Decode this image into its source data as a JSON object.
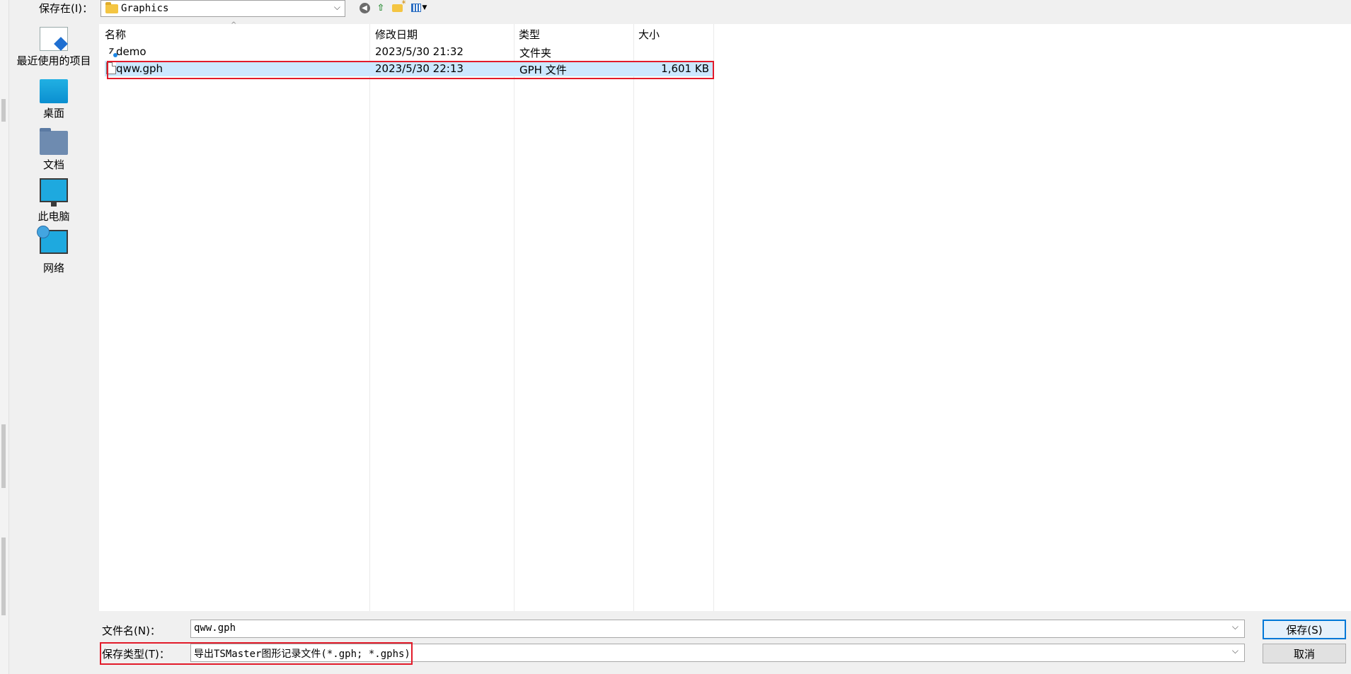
{
  "toolbar": {
    "save_in_label": "保存在(I)：",
    "location": "Graphics"
  },
  "places": [
    {
      "label": "最近使用的项目",
      "icon": "recent-items-icon"
    },
    {
      "label": "桌面",
      "icon": "desktop-icon"
    },
    {
      "label": "文档",
      "icon": "documents-icon"
    },
    {
      "label": "此电脑",
      "icon": "this-pc-icon"
    },
    {
      "label": "网络",
      "icon": "network-icon"
    }
  ],
  "columns": {
    "name": "名称",
    "date": "修改日期",
    "type": "类型",
    "size": "大小"
  },
  "files": [
    {
      "name": "demo",
      "date": "2023/5/30 21:32",
      "type": "文件夹",
      "size": ""
    },
    {
      "name": "qww.gph",
      "date": "2023/5/30 22:13",
      "type": "GPH 文件",
      "size": "1,601 KB"
    }
  ],
  "filename": {
    "label": "文件名(N)：",
    "value": "qww.gph"
  },
  "filetype": {
    "label": "保存类型(T)：",
    "value": "导出TSMaster图形记录文件(*.gph; *.gphs)"
  },
  "buttons": {
    "save": "保存(S)",
    "cancel": "取消"
  },
  "colors": {
    "selection": "#cce8ff",
    "highlight_box": "#e21b2a",
    "default_button_border": "#0078d7"
  }
}
